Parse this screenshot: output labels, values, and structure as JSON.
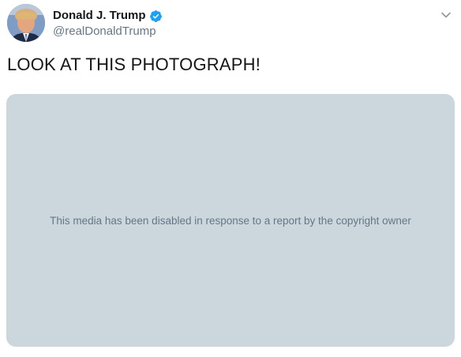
{
  "author": {
    "display_name": "Donald J. Trump",
    "handle": "@realDonaldTrump",
    "verified": true,
    "avatar_icon": "profile-photo"
  },
  "tweet": {
    "text": "LOOK AT THIS PHOTOGRAPH!"
  },
  "media": {
    "disabled_message": "This media has been disabled in response to a report by the copyright owner"
  },
  "icons": {
    "verified": "verified-badge-icon",
    "menu": "chevron-down-icon"
  },
  "colors": {
    "verified_blue": "#1da1f2",
    "media_placeholder": "#ccd6dd",
    "secondary_text": "#657786",
    "primary_text": "#14171a"
  }
}
